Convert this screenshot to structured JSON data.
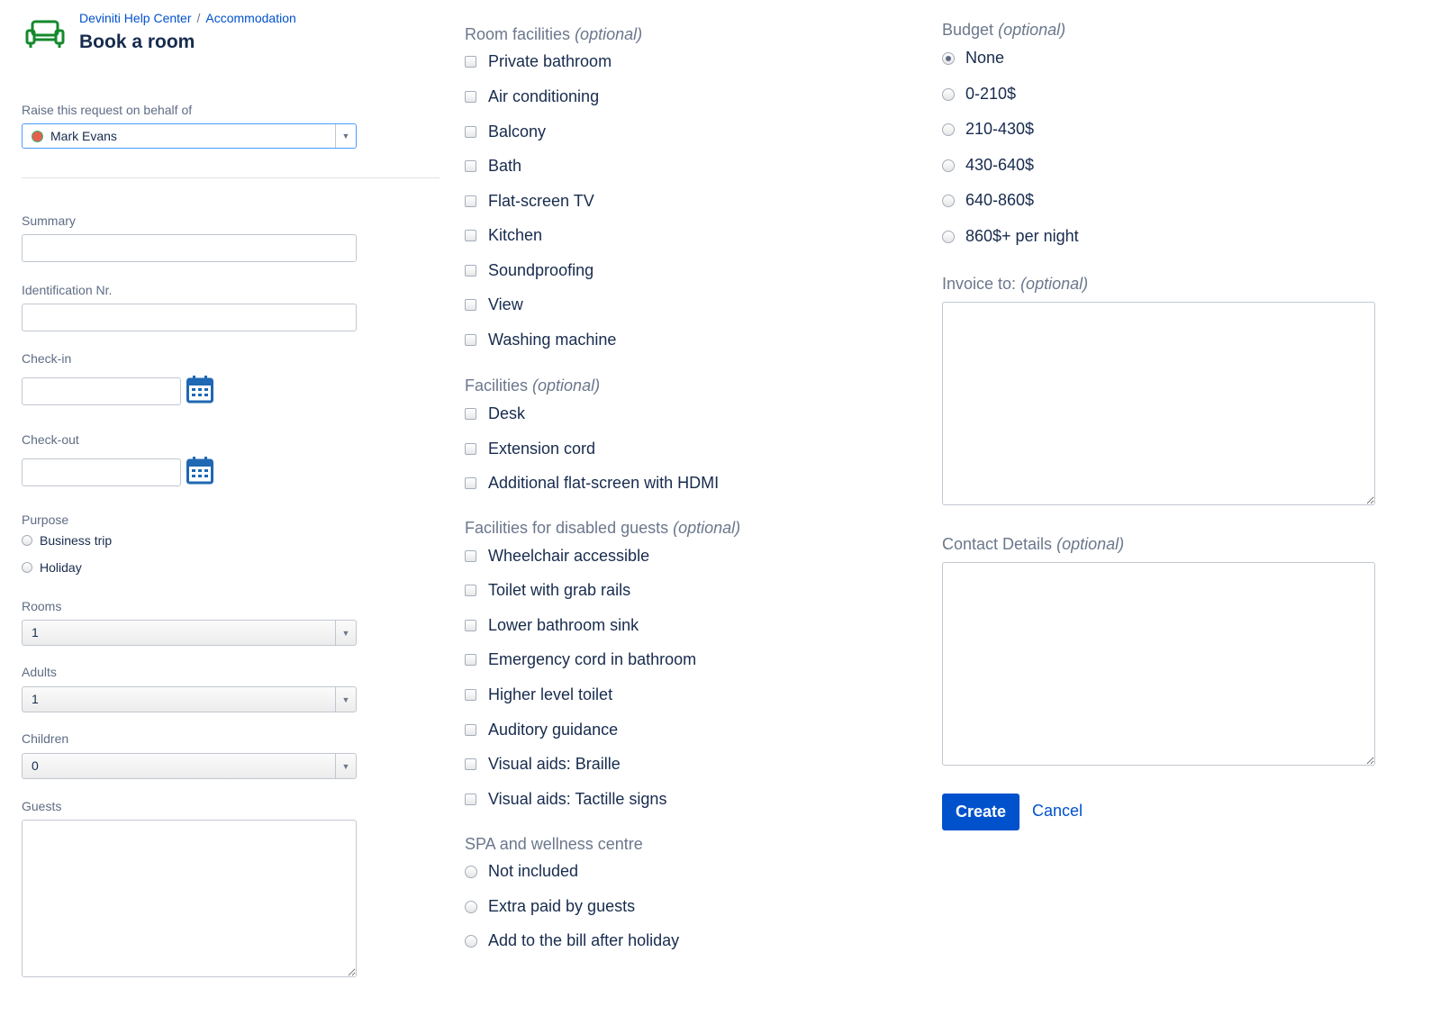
{
  "header": {
    "breadcrumb": [
      "Deviniti Help Center",
      "Accommodation"
    ],
    "breadcrumb_separator": "/",
    "title": "Book a room",
    "icon": "sofa-icon",
    "accent_color": "#0052cc",
    "icon_color": "#14892c"
  },
  "left": {
    "behalf_label": "Raise this request on behalf of",
    "behalf_value": "Mark Evans",
    "summary_label": "Summary",
    "summary_value": "",
    "idnr_label": "Identification Nr.",
    "idnr_value": "",
    "checkin_label": "Check-in",
    "checkin_value": "",
    "checkout_label": "Check-out",
    "checkout_value": "",
    "purpose_label": "Purpose",
    "purpose_options": [
      "Business trip",
      "Holiday"
    ],
    "rooms_label": "Rooms",
    "rooms_value": "1",
    "adults_label": "Adults",
    "adults_value": "1",
    "children_label": "Children",
    "children_value": "0",
    "guests_label": "Guests",
    "guests_value": ""
  },
  "middle": {
    "optional": "(optional)",
    "room_facilities_label": "Room facilities",
    "room_facilities": [
      "Private bathroom",
      "Air conditioning",
      "Balcony",
      "Bath",
      "Flat-screen TV",
      "Kitchen",
      "Soundproofing",
      "View",
      "Washing machine"
    ],
    "facilities_label": "Facilities",
    "facilities": [
      "Desk",
      "Extension cord",
      "Additional flat-screen with HDMI"
    ],
    "disabled_label": "Facilities for disabled guests",
    "disabled": [
      "Wheelchair accessible",
      "Toilet with grab rails",
      "Lower bathroom sink",
      "Emergency cord in bathroom",
      "Higher level toilet",
      "Auditory guidance",
      "Visual aids: Braille",
      "Visual aids: Tactille signs"
    ],
    "spa_label": "SPA and wellness centre",
    "spa_options": [
      "Not included",
      "Extra paid by guests",
      "Add to the bill after holiday"
    ]
  },
  "right": {
    "optional": "(optional)",
    "budget_label": "Budget",
    "budget_options": [
      "None",
      "0-210$",
      "210-430$",
      "430-640$",
      "640-860$",
      "860$+ per night"
    ],
    "budget_selected": "None",
    "invoice_label": "Invoice to:",
    "invoice_value": "",
    "contact_label": "Contact Details",
    "contact_value": "",
    "create_label": "Create",
    "cancel_label": "Cancel"
  }
}
